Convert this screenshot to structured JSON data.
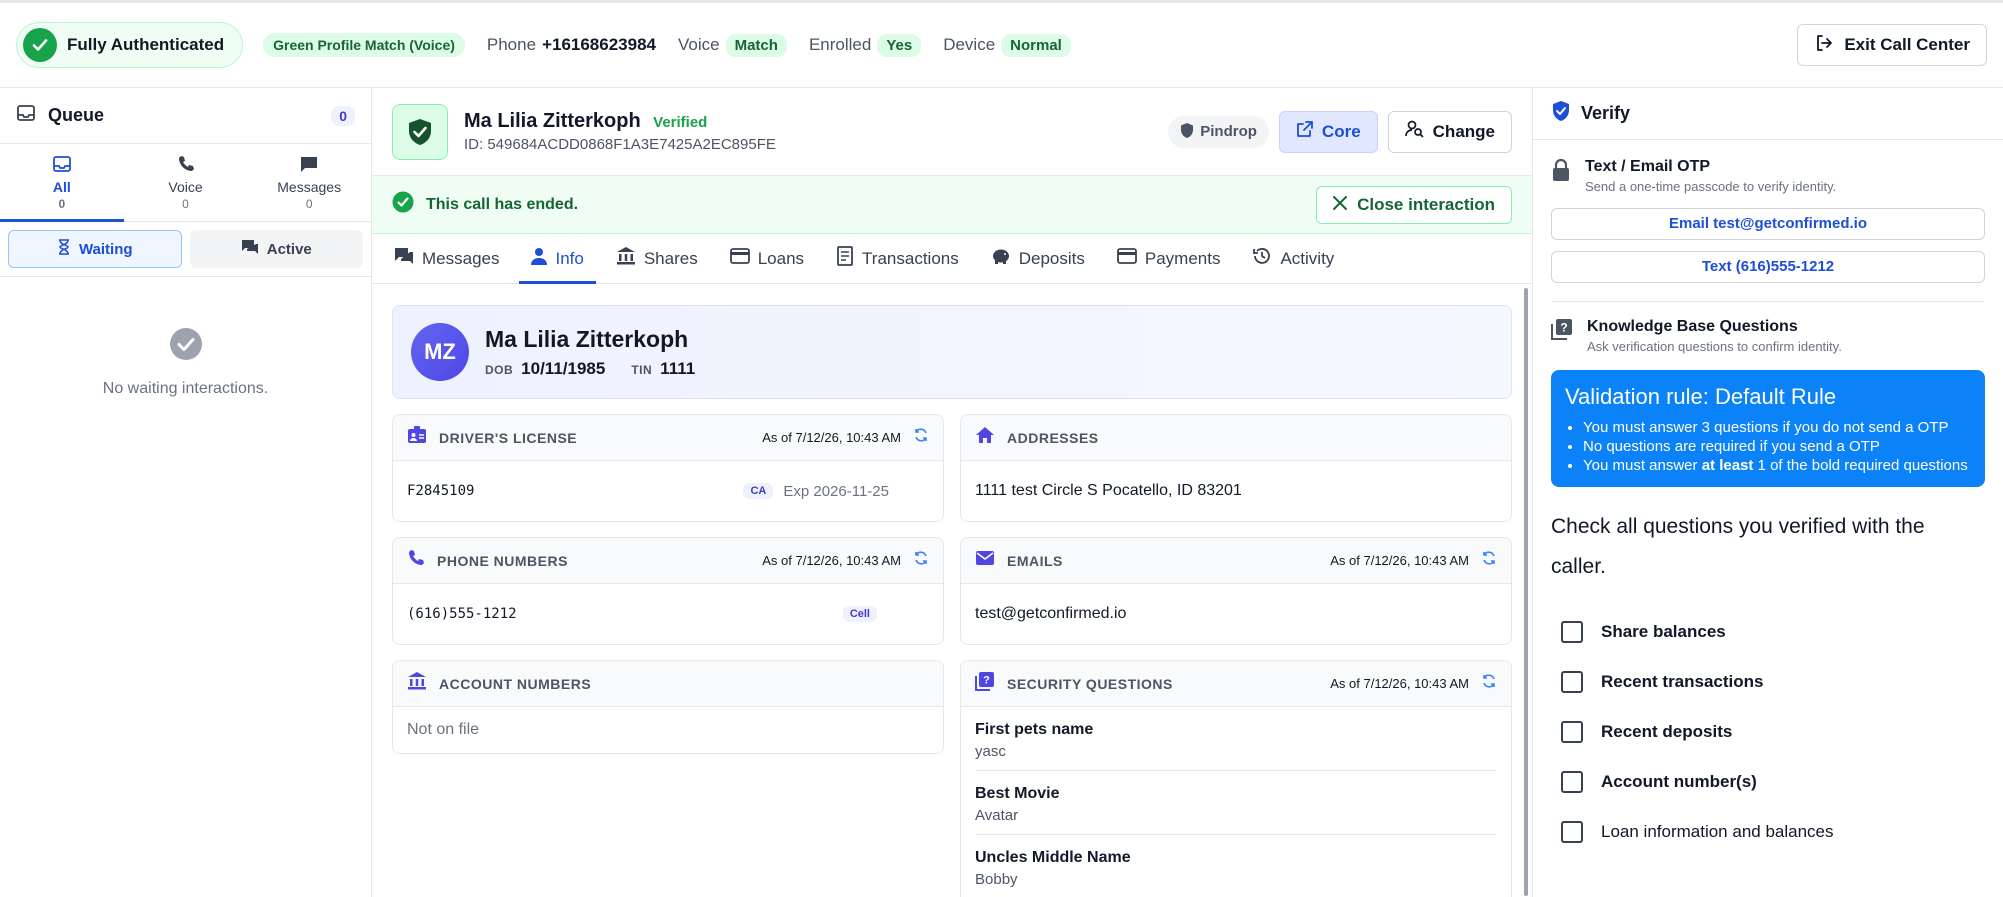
{
  "topbar": {
    "auth_label": "Fully Authenticated",
    "profile_badge": "Green Profile Match (Voice)",
    "phone_label": "Phone",
    "phone_value": "+16168623984",
    "voice_label": "Voice",
    "voice_value": "Match",
    "enrolled_label": "Enrolled",
    "enrolled_value": "Yes",
    "device_label": "Device",
    "device_value": "Normal",
    "exit_label": "Exit Call Center"
  },
  "queue": {
    "title": "Queue",
    "count": "0",
    "tabs": [
      {
        "label": "All",
        "count": "0"
      },
      {
        "label": "Voice",
        "count": "0"
      },
      {
        "label": "Messages",
        "count": "0"
      }
    ],
    "waiting_label": "Waiting",
    "active_label": "Active",
    "empty_text": "No waiting interactions."
  },
  "member": {
    "name": "Ma Lilia Zitterkoph",
    "verified_label": "Verified",
    "id_text": "ID: 549684ACDD0868F1A3E7425A2EC895FE",
    "pindrop_label": "Pindrop",
    "core_label": "Core",
    "change_label": "Change"
  },
  "call_status": {
    "text": "This call has ended.",
    "close_label": "Close interaction"
  },
  "tabs": [
    "Messages",
    "Info",
    "Shares",
    "Loans",
    "Transactions",
    "Deposits",
    "Payments",
    "Activity"
  ],
  "profile": {
    "initials": "MZ",
    "name": "Ma Lilia Zitterkoph",
    "dob_label": "DOB",
    "dob": "10/11/1985",
    "tin_label": "TIN",
    "tin": "1111"
  },
  "cards": {
    "license": {
      "title": "DRIVER'S LICENSE",
      "asof": "As of 7/12/26, 10:43 AM",
      "number": "F2845109",
      "state": "CA",
      "exp": "Exp 2026-11-25"
    },
    "addresses": {
      "title": "ADDRESSES",
      "value": "1111 test Circle S Pocatello, ID 83201"
    },
    "phones": {
      "title": "PHONE NUMBERS",
      "asof": "As of 7/12/26, 10:43 AM",
      "number": "(616)555-1212",
      "type": "Cell"
    },
    "emails": {
      "title": "EMAILS",
      "asof": "As of 7/12/26, 10:43 AM",
      "value": "test@getconfirmed.io"
    },
    "accounts": {
      "title": "ACCOUNT NUMBERS",
      "value": "Not on file"
    },
    "security": {
      "title": "SECURITY QUESTIONS",
      "asof": "As of 7/12/26, 10:43 AM",
      "items": [
        {
          "q": "First pets name",
          "a": "yasc"
        },
        {
          "q": "Best Movie",
          "a": "Avatar"
        },
        {
          "q": "Uncles Middle Name",
          "a": "Bobby"
        }
      ]
    }
  },
  "verify": {
    "title": "Verify",
    "otp_title": "Text / Email OTP",
    "otp_sub": "Send a one-time passcode to verify identity.",
    "email_btn": "Email test@getconfirmed.io",
    "text_btn": "Text (616)555-1212",
    "kb_title": "Knowledge Base Questions",
    "kb_sub": "Ask verification questions to confirm identity.",
    "rule_title": "Validation rule: Default Rule",
    "rule_1": "You must answer 3 questions if you do not send a OTP",
    "rule_2": "No questions are required if you send a OTP",
    "rule_3a": "You must answer ",
    "rule_3b": "at least",
    "rule_3c": " 1 of the bold required questions",
    "check_intro": "Check all questions you verified with the caller.",
    "checks": [
      {
        "label": "Share balances",
        "bold": true
      },
      {
        "label": "Recent transactions",
        "bold": true
      },
      {
        "label": "Recent deposits",
        "bold": true
      },
      {
        "label": "Account number(s)",
        "bold": true
      },
      {
        "label": "Loan information and balances",
        "bold": false
      }
    ]
  },
  "colors": {
    "accent": "#1d4ed8",
    "success": "#16a34a",
    "rule_bg": "#0b82f7"
  }
}
